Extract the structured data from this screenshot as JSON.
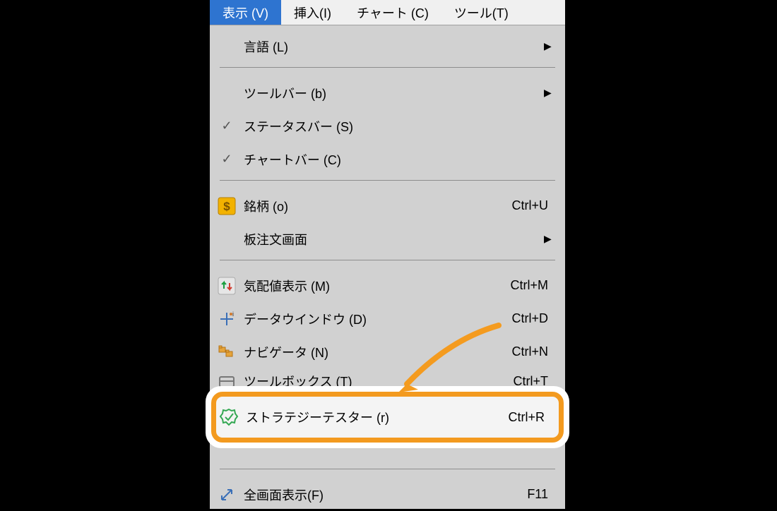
{
  "menubar": {
    "view": "表示 (V)",
    "insert": "挿入(I)",
    "chart": "チャート (C)",
    "tools": "ツール(T)"
  },
  "items": {
    "language": {
      "label": "言語 (L)"
    },
    "toolbars": {
      "label": "ツールバー (b)"
    },
    "statusbar": {
      "label": "ステータスバー (S)"
    },
    "chartbar": {
      "label": "チャートバー (C)"
    },
    "symbols": {
      "label": "銘柄 (o)",
      "shortcut": "Ctrl+U"
    },
    "depth": {
      "label": "板注文画面"
    },
    "marketwatch": {
      "label": "気配値表示 (M)",
      "shortcut": "Ctrl+M"
    },
    "datawindow": {
      "label": "データウインドウ (D)",
      "shortcut": "Ctrl+D"
    },
    "navigator": {
      "label": "ナビゲータ (N)",
      "shortcut": "Ctrl+N"
    },
    "toolbox": {
      "label": "ツールボックス (T)",
      "shortcut": "Ctrl+T"
    },
    "strategytester": {
      "label": "ストラテジーテスター (r)",
      "shortcut": "Ctrl+R"
    },
    "fullscreen": {
      "label": "全画面表示(F)",
      "shortcut": "F11"
    }
  }
}
